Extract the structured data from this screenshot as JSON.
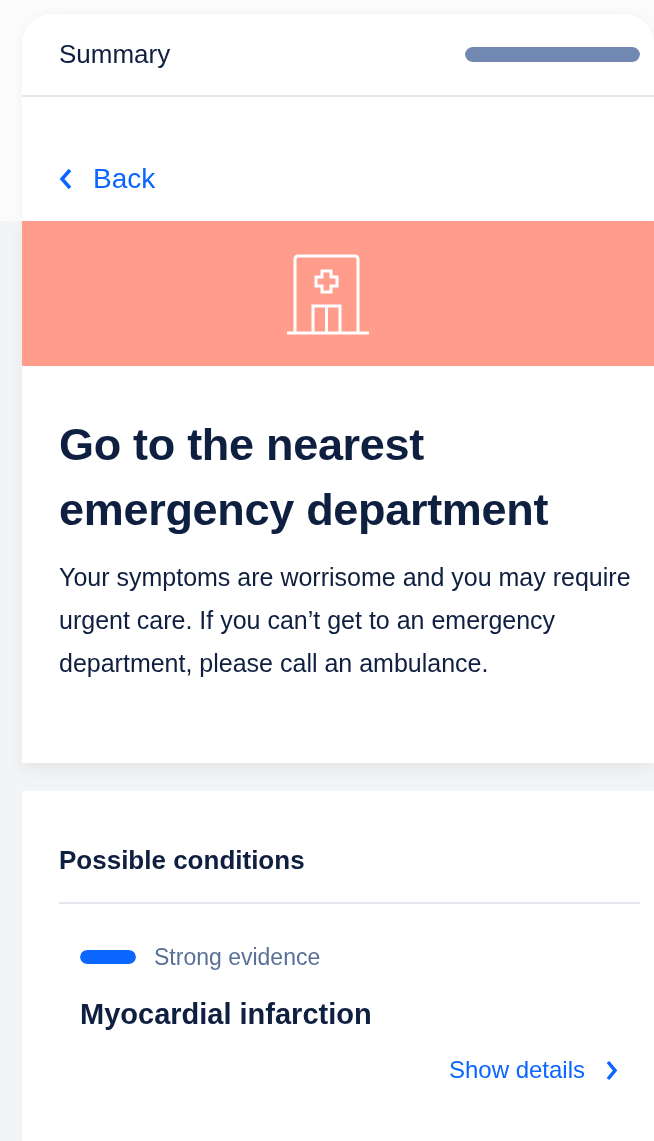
{
  "header": {
    "title": "Summary",
    "progress": {
      "level": 1
    }
  },
  "back_link": {
    "label": "Back"
  },
  "recommendation": {
    "title": "Go to the nearest emergency department",
    "description": "Your symptoms are worrisome and you may require urgent care. If you can’t get to an emergency department, please call an ambulance."
  },
  "conditions": {
    "title": "Possible conditions",
    "items": [
      {
        "evidence": "Strong evidence",
        "level": 1,
        "name": "Myocardial infarction",
        "link": "Show details"
      }
    ]
  }
}
